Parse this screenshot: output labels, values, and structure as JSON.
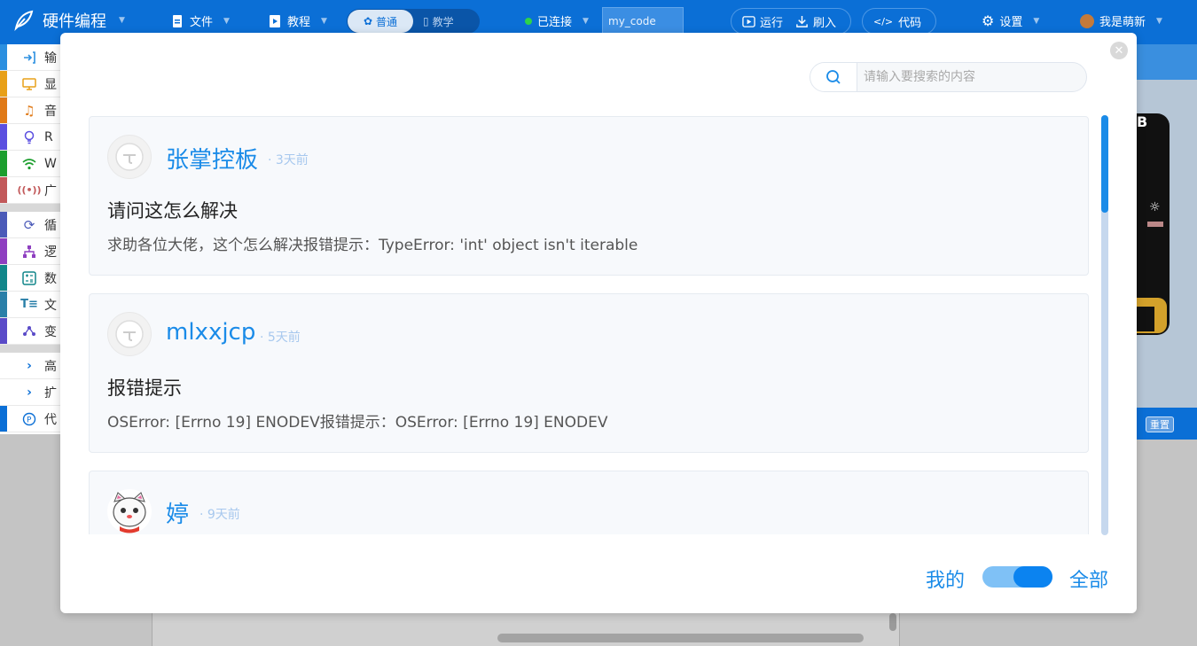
{
  "topbar": {
    "app_title": "硬件编程",
    "file_menu": "文件",
    "tutorial_menu": "教程",
    "mode_normal": "普通",
    "mode_teach": "教学",
    "connection_status": "已连接",
    "code_name": "my_code",
    "run_label": "运行",
    "flash_label": "刷入",
    "code_label": "代码",
    "settings_label": "设置",
    "user_label": "我是萌新"
  },
  "sidebar": {
    "items": [
      {
        "label": "输",
        "icon": "input-icon",
        "color": "#2b8fe0"
      },
      {
        "label": "显",
        "icon": "display-icon",
        "color": "#e8a018"
      },
      {
        "label": "音",
        "icon": "music-icon",
        "color": "#e07a18"
      },
      {
        "label": "R",
        "icon": "bulb-icon",
        "color": "#5b4fe0"
      },
      {
        "label": "W",
        "icon": "wifi-icon",
        "color": "#1c9e2e"
      },
      {
        "label": "广",
        "icon": "broadcast-icon",
        "color": "#c2595a"
      },
      {
        "label": "循",
        "icon": "loop-icon",
        "color": "#4b5ab8"
      },
      {
        "label": "逻",
        "icon": "logic-icon",
        "color": "#8e3fc0"
      },
      {
        "label": "数",
        "icon": "math-icon",
        "color": "#11868a"
      },
      {
        "label": "文",
        "icon": "text-icon",
        "color": "#2a7fa8"
      },
      {
        "label": "变",
        "icon": "variable-icon",
        "color": "#5a4bc8"
      },
      {
        "label": "高",
        "icon": "chevron-right-icon",
        "color": "#ffffff"
      },
      {
        "label": "扩",
        "icon": "chevron-right-icon",
        "color": "#ffffff"
      },
      {
        "label": "代",
        "icon": "python-icon",
        "color": "#0b6fd6"
      }
    ]
  },
  "right_panel": {
    "board_letter": "B",
    "reset_label": "重置"
  },
  "modal": {
    "search_placeholder": "请输入要搜索的内容",
    "posts": [
      {
        "user": "张掌控板",
        "time": "· 3天前",
        "title": "请问这怎么解决",
        "body": "求助各位大佬，这个怎么解决报错提示：TypeError: 'int' object isn't iterable"
      },
      {
        "user": "mlxxjcp",
        "time": "· 5天前",
        "title": "报错提示",
        "body": "OSError: [Errno 19] ENODEV报错提示：OSError: [Errno 19] ENODEV"
      },
      {
        "user": "婷",
        "time": "· 9天前",
        "title": "",
        "body": ""
      }
    ],
    "footer_mine": "我的",
    "footer_all": "全部",
    "toggle_state": "全部"
  },
  "colors": {
    "brand_blue": "#0b6fd6",
    "link_blue": "#1a8be8"
  }
}
